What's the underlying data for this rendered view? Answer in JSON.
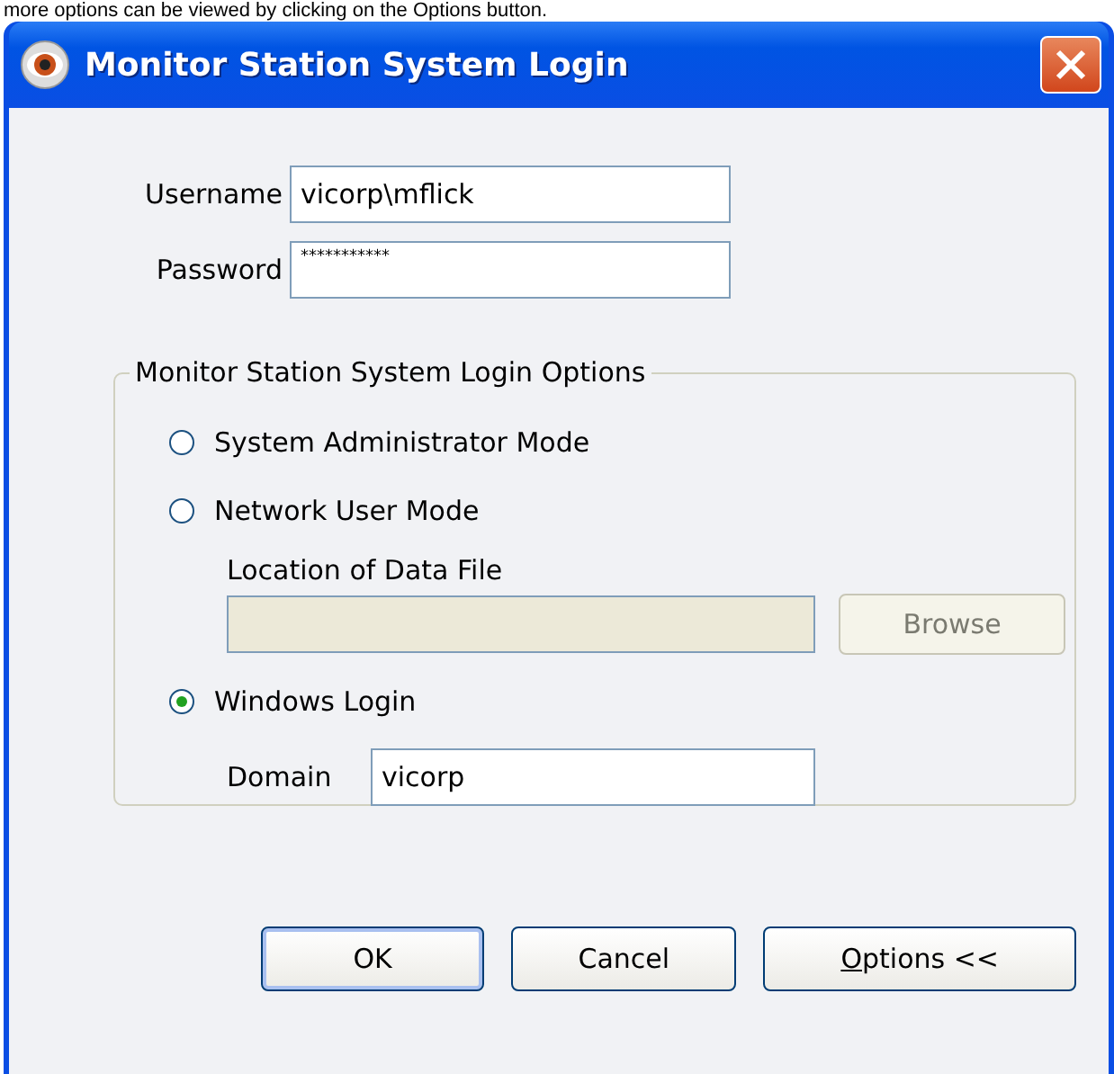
{
  "caption": "more options can be viewed by clicking on the Options button.",
  "window": {
    "title": "Monitor Station System Login"
  },
  "fields": [
    {
      "label": "Username",
      "value": "vicorp\\mflick",
      "kind": "text"
    },
    {
      "label": "Password",
      "value": "***********",
      "kind": "password"
    }
  ],
  "options_group": {
    "title": "Monitor Station System Login Options",
    "modes": [
      {
        "label": "System Administrator Mode",
        "selected": false
      },
      {
        "label": "Network User Mode",
        "selected": false,
        "data_file": {
          "label": "Location of Data File",
          "disabled": true,
          "button": "Browse"
        }
      },
      {
        "label": "Windows Login",
        "selected": true,
        "domain": {
          "label": "Domain",
          "value": "vicorp"
        }
      }
    ]
  },
  "buttons": [
    {
      "label": "OK",
      "default": true
    },
    {
      "label": "Cancel",
      "default": false
    },
    {
      "label": "Options <<",
      "default": false
    }
  ]
}
